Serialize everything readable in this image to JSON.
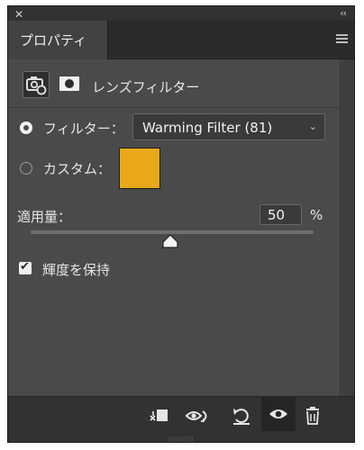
{
  "window": {
    "close_glyph": "✕",
    "collapse_glyph": "‹‹"
  },
  "tabs": [
    {
      "label": "プロパティ",
      "active": true
    }
  ],
  "header": {
    "title": "レンズフィルター",
    "icons": [
      "adjustment-camera-icon",
      "mask-icon"
    ]
  },
  "filter_option": {
    "label": "フィルター：",
    "selected": true,
    "dropdown_value": "Warming Filter (81)"
  },
  "custom_option": {
    "label": "カスタム：",
    "selected": false,
    "swatch_color": "#e8a81a"
  },
  "density": {
    "label": "適用量：",
    "value": "50",
    "unit": "%",
    "slider_fraction": 0.5
  },
  "preserve_luminosity": {
    "label": "輝度を保持",
    "checked": true,
    "check_glyph": "✔"
  },
  "toolbar": {
    "buttons": [
      "clip-to-layer-icon",
      "view-previous-state-icon",
      "reset-icon",
      "toggle-visibility-icon",
      "delete-icon"
    ]
  },
  "colors": {
    "panel_bg": "#4a4a4a",
    "dark_bg": "#323232",
    "text": "#e6e6e6"
  }
}
